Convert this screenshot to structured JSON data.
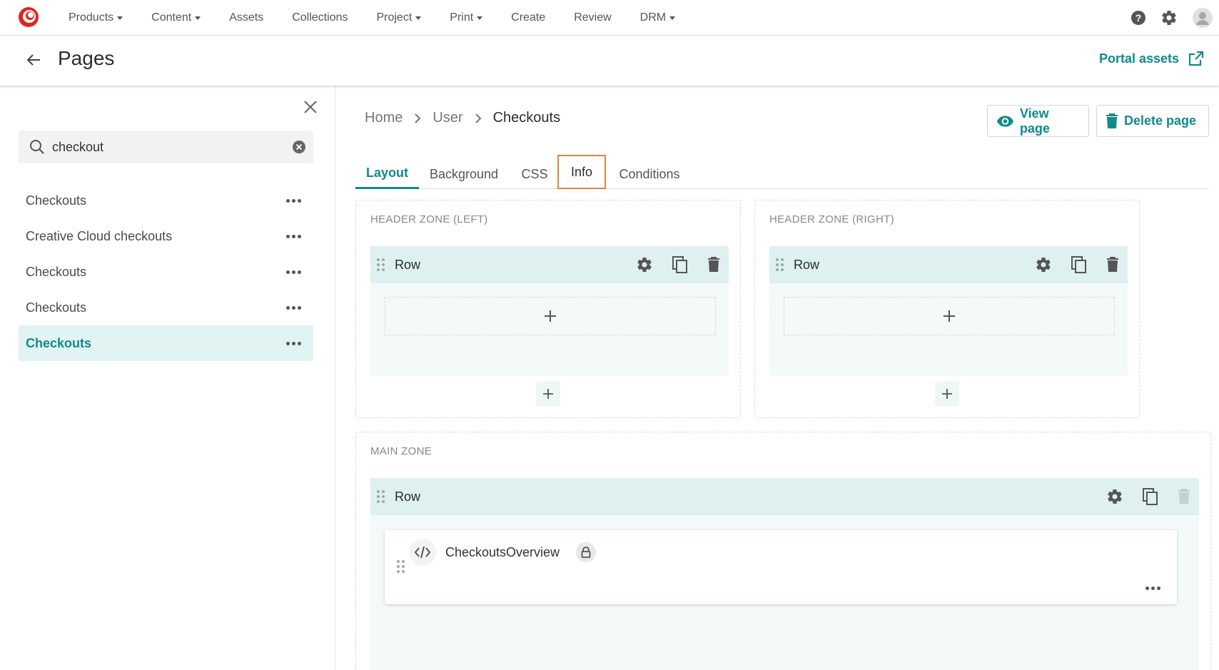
{
  "nav": {
    "items": [
      {
        "label": "Products",
        "dropdown": true
      },
      {
        "label": "Content",
        "dropdown": true
      },
      {
        "label": "Assets",
        "dropdown": false
      },
      {
        "label": "Collections",
        "dropdown": false
      },
      {
        "label": "Project",
        "dropdown": true
      },
      {
        "label": "Print",
        "dropdown": true
      },
      {
        "label": "Create",
        "dropdown": false
      },
      {
        "label": "Review",
        "dropdown": false
      },
      {
        "label": "DRM",
        "dropdown": true
      }
    ],
    "icons": [
      "help-icon",
      "settings-gear-icon",
      "user-avatar-icon"
    ]
  },
  "header": {
    "title": "Pages",
    "portal_assets_label": "Portal assets"
  },
  "sidebar": {
    "search_value": "checkout",
    "items": [
      {
        "label": "Checkouts",
        "active": false
      },
      {
        "label": "Creative Cloud checkouts",
        "active": false
      },
      {
        "label": "Checkouts",
        "active": false
      },
      {
        "label": "Checkouts",
        "active": false
      },
      {
        "label": "Checkouts",
        "active": true
      }
    ]
  },
  "main": {
    "breadcrumb": [
      "Home",
      "User",
      "Checkouts"
    ],
    "view_page_label": "View page",
    "delete_page_label": "Delete page",
    "tabs": [
      {
        "label": "Layout",
        "state": "active"
      },
      {
        "label": "Background",
        "state": "normal"
      },
      {
        "label": "CSS",
        "state": "normal"
      },
      {
        "label": "Info",
        "state": "highlighted"
      },
      {
        "label": "Conditions",
        "state": "normal"
      }
    ],
    "zones": {
      "header_left": {
        "label": "HEADER ZONE (LEFT)",
        "row_label": "Row"
      },
      "header_right": {
        "label": "HEADER ZONE (RIGHT)",
        "row_label": "Row"
      },
      "main": {
        "label": "MAIN ZONE",
        "row_label": "Row",
        "component_name": "CheckoutsOverview"
      }
    }
  },
  "colors": {
    "accent": "#118a8a",
    "active_bg": "#e1f3f2",
    "row_bar": "#def0ef",
    "highlight_border": "#e8833a",
    "logo_red": "#e2241b"
  }
}
